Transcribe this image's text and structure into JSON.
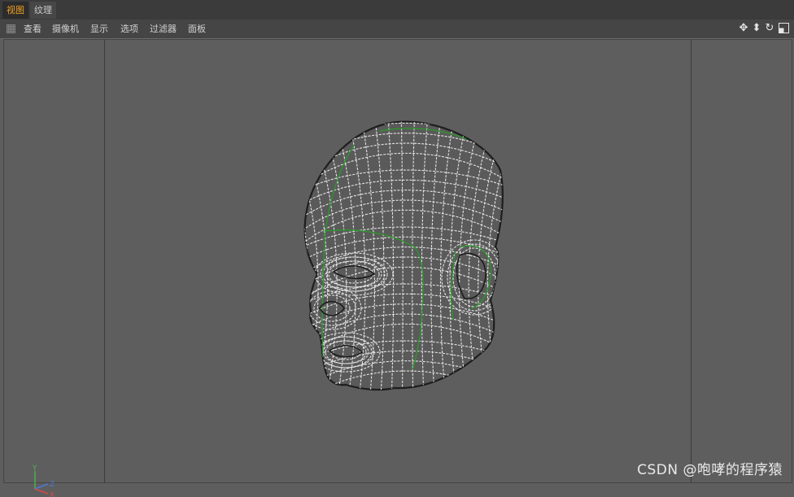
{
  "tabs": [
    {
      "label": "视图",
      "active": true
    },
    {
      "label": "纹理",
      "active": false
    }
  ],
  "menu": [
    "查看",
    "摄像机",
    "显示",
    "选项",
    "过滤器",
    "面板"
  ],
  "nav_icons": [
    "move-view-icon",
    "scale-view-icon",
    "rotate-view-icon",
    "toggle-panel-icon"
  ],
  "axis": {
    "y": "Y",
    "z": "Z",
    "x": "X"
  },
  "watermark": "CSDN @咆哮的程序猿",
  "colors": {
    "viewport_bg": "#5e5e5e",
    "active_tab": "#f0a020",
    "wire": "#e8e8e8",
    "wire_green": "#2a9a2a",
    "axis_y": "#4caf50",
    "axis_z": "#4a7ad8",
    "axis_x": "#d84a4a"
  }
}
